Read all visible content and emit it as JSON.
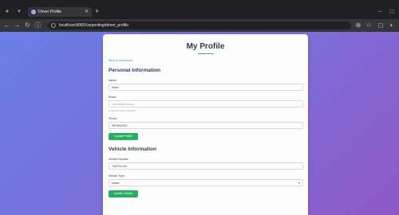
{
  "browser": {
    "tab_title": "Driver Profile",
    "url": "localhost:8000/carpooling/driver_profile"
  },
  "page": {
    "title": "My Profile",
    "back_link": "Back to Dashboard"
  },
  "personal": {
    "heading": "Personal Information",
    "name_label": "Name:",
    "name_value": "driver",
    "email_label": "Email:",
    "email_placeholder": "driver@gmail.com",
    "email_help": "Email cannot be changed",
    "phone_label": "Phone:",
    "phone_value": "9876543210",
    "button": "Update Profile"
  },
  "vehicle": {
    "heading": "Vehicle Information",
    "number_label": "Vehicle Number:",
    "number_value": "TN07S1234",
    "type_label": "Vehicle Type:",
    "type_value": "sedan",
    "button": "Update Vehicle"
  },
  "colors": {
    "accent": "#3498db",
    "button": "#27ae60",
    "gradient_start": "#6a7fe6",
    "gradient_end": "#8e58c8"
  }
}
